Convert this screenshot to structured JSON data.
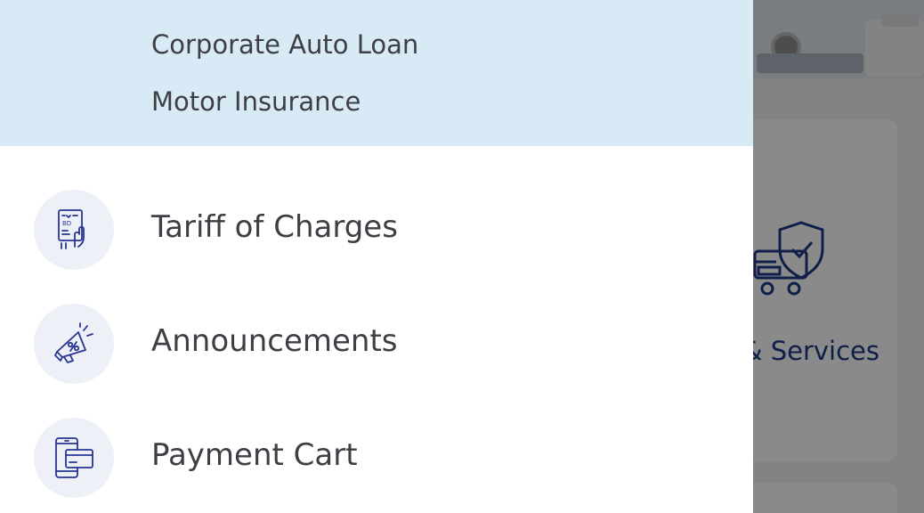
{
  "submenu": {
    "items": [
      {
        "label": "Corporate Auto Loan",
        "icon": "none"
      },
      {
        "label": "Motor Insurance",
        "icon": "none"
      }
    ]
  },
  "menu": {
    "items": [
      {
        "label": "Tariff of Charges",
        "icon": "tariff-document-icon"
      },
      {
        "label": "Announcements",
        "icon": "megaphone-icon"
      },
      {
        "label": "Payment Cart",
        "icon": "mobile-payment-icon"
      }
    ]
  },
  "background": {
    "card_label": "& Services",
    "card_icon": "insurance-shield-icon"
  },
  "colors": {
    "submenu_bg": "#d8eaf6",
    "icon_circle_bg": "#eef0f7",
    "icon_stroke": "#283593",
    "text": "#3d3f45",
    "brand_text": "#1f3a8a"
  }
}
